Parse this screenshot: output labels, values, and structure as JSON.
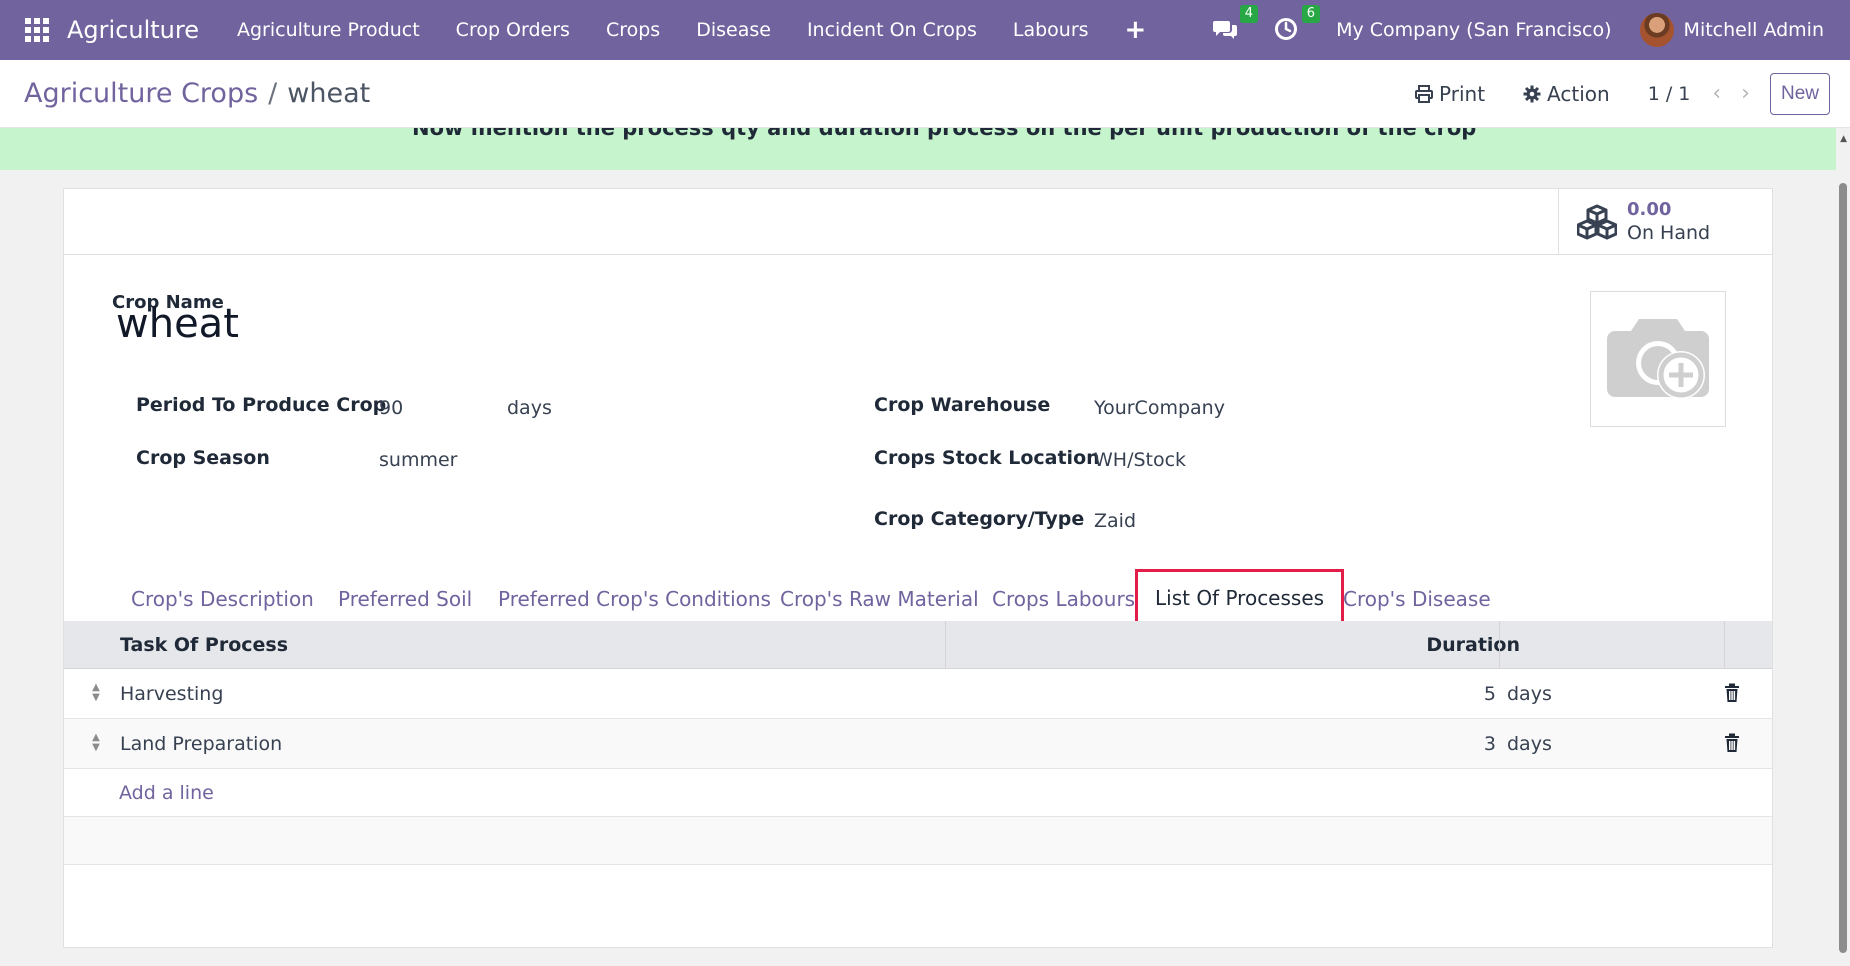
{
  "nav": {
    "app_name": "Agriculture",
    "menu": [
      "Agriculture Product",
      "Crop Orders",
      "Crops",
      "Disease",
      "Incident On Crops",
      "Labours"
    ],
    "plus": "+",
    "messages_count": "4",
    "activities_count": "6",
    "company": "My Company (San Francisco)",
    "user": "Mitchell Admin"
  },
  "control": {
    "breadcrumb_parent": "Agriculture Crops",
    "breadcrumb_sep": "/",
    "breadcrumb_current": "wheat",
    "print_label": "Print",
    "action_label": "Action",
    "pager": "1 / 1",
    "prev": "‹",
    "next": "›",
    "new_label": "New"
  },
  "banner": {
    "text": "Now mention the process qty and duration process on the per unit production of the crop"
  },
  "stat": {
    "value": "0.00",
    "label": "On Hand"
  },
  "form": {
    "crop_name_label": "Crop Name",
    "crop_name": "wheat",
    "period_label": "Period To Produce Crop",
    "period_value": "90",
    "period_unit": "days",
    "season_label": "Crop Season",
    "season_value": "summer",
    "warehouse_label": "Crop Warehouse",
    "warehouse_value": "YourCompany",
    "stock_label": "Crops Stock Location",
    "stock_value": "WH/Stock",
    "category_label": "Crop Category/Type",
    "category_value": "Zaid"
  },
  "tabs": [
    "Crop's Description",
    "Preferred Soil",
    "Preferred Crop's Conditions",
    "Crop's Raw Material",
    "Crops Labours",
    "List Of Processes",
    "Crop's Disease"
  ],
  "active_tab": "List Of Processes",
  "table": {
    "headers": {
      "task": "Task Of Process",
      "duration": "Duration"
    },
    "rows": [
      {
        "task": "Harvesting",
        "duration": "5",
        "unit": "days"
      },
      {
        "task": "Land Preparation",
        "duration": "3",
        "unit": "days"
      }
    ],
    "add_line": "Add a line"
  },
  "colors": {
    "brand": "#71639e",
    "banner": "#c6f5cd",
    "highlight": "#e11d48",
    "badge": "#28a745"
  }
}
